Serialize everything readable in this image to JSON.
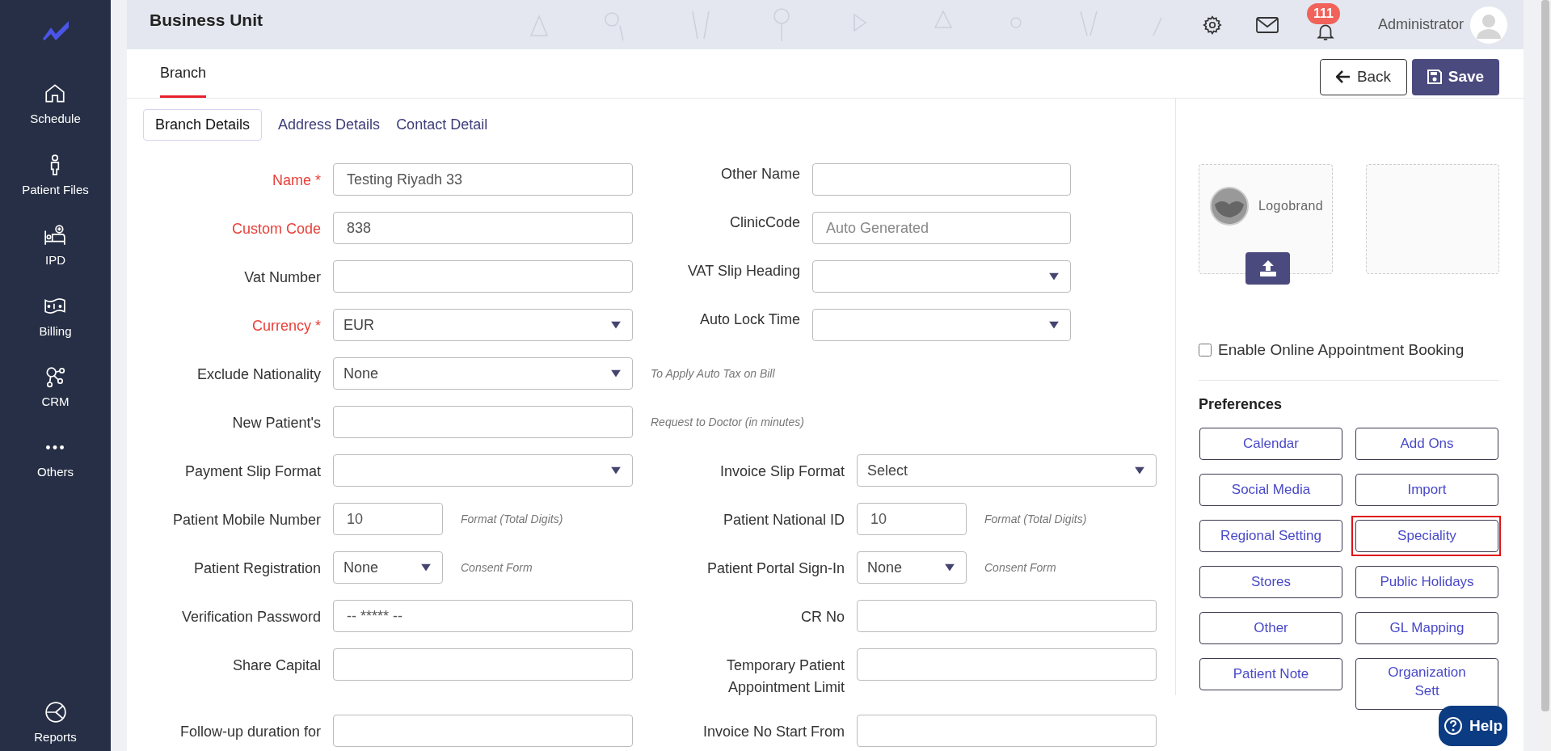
{
  "sidebar": {
    "items": [
      {
        "label": "Schedule"
      },
      {
        "label": "Patient Files"
      },
      {
        "label": "IPD"
      },
      {
        "label": "Billing"
      },
      {
        "label": "CRM"
      },
      {
        "label": "Others"
      }
    ],
    "bottom_item": {
      "label": "Reports"
    }
  },
  "header": {
    "title": "Business Unit",
    "notification_count": "111",
    "user": "Administrator"
  },
  "page_tabs": [
    {
      "label": "Branch",
      "selected": true
    }
  ],
  "actions": [
    {
      "label": "Back",
      "kind": "back"
    },
    {
      "label": "Save",
      "kind": "save"
    }
  ],
  "section_tabs": [
    {
      "label": "Branch Details",
      "selected": true
    },
    {
      "label": "Address Details",
      "selected": false
    },
    {
      "label": "Contact Detail",
      "selected": false
    }
  ],
  "rows": [
    {
      "kind": "top",
      "left": {
        "label": "Name *",
        "required": true,
        "kind": "text",
        "value": "Testing Riyadh 33"
      },
      "right": {
        "label": "Other Name",
        "required": false,
        "kind": "text"
      }
    },
    {
      "kind": "top",
      "left": {
        "label": "Custom Code",
        "required": true,
        "kind": "text",
        "value": "838"
      },
      "right": {
        "label": "ClinicCode",
        "required": false,
        "kind": "text",
        "placeholder": "Auto Generated"
      }
    },
    {
      "kind": "top",
      "left": {
        "label": "Vat Number",
        "required": false,
        "kind": "text"
      },
      "right": {
        "label": "VAT Slip Heading",
        "required": false,
        "kind": "select"
      }
    },
    {
      "kind": "top",
      "left": {
        "label": "Currency *",
        "required": true,
        "kind": "select",
        "value": "EUR"
      },
      "right": {
        "label": "Auto Lock Time",
        "required": false,
        "kind": "select"
      }
    },
    {
      "kind": "single",
      "left": {
        "label": "Exclude Nationality",
        "required": false,
        "kind": "select",
        "value": "None",
        "hint": "To Apply Auto Tax on Bill"
      }
    },
    {
      "kind": "single",
      "left": {
        "label": "New Patient's",
        "required": false,
        "kind": "text",
        "hint": "Request to Doctor (in minutes)"
      }
    },
    {
      "kind": "pair",
      "left": {
        "label": "Payment Slip Format",
        "required": false,
        "kind": "select"
      },
      "right": {
        "label": "Invoice Slip Format",
        "required": false,
        "kind": "select",
        "value": "Select"
      }
    },
    {
      "kind": "pair",
      "left": {
        "label": "Patient Mobile Number",
        "required": false,
        "kind": "short-text",
        "value": "10",
        "hint": "Format (Total Digits)"
      },
      "right": {
        "label": "Patient National ID",
        "required": false,
        "kind": "short-text",
        "value": "10",
        "hint": "Format (Total Digits)"
      }
    },
    {
      "kind": "pair",
      "left": {
        "label": "Patient Registration",
        "required": false,
        "kind": "short-select",
        "value": "None",
        "hint": "Consent Form"
      },
      "right": {
        "label": "Patient Portal Sign-In",
        "required": false,
        "kind": "short-select",
        "value": "None",
        "hint": "Consent Form"
      }
    },
    {
      "kind": "pair",
      "left": {
        "label": "Verification Password",
        "required": false,
        "kind": "text",
        "value": "-- ***** --"
      },
      "right": {
        "label": "CR No",
        "required": false,
        "kind": "wide-text"
      }
    },
    {
      "kind": "pair",
      "left": {
        "label": "Share Capital",
        "required": false,
        "kind": "text"
      },
      "right": {
        "label": "Temporary Patient Appointment Limit",
        "required": false,
        "kind": "wide-text"
      }
    },
    {
      "kind": "pair",
      "left": {
        "label": "Follow-up duration for",
        "required": false,
        "kind": "text"
      },
      "right": {
        "label": "Invoice No Start From",
        "required": false,
        "kind": "wide-text"
      }
    }
  ],
  "logo": {
    "label": "Logobrand"
  },
  "online_booking": {
    "label": "Enable Online Appointment Booking",
    "checked": false
  },
  "preferences": {
    "title": "Preferences",
    "buttons": [
      {
        "label": "Calendar",
        "highlighted": false
      },
      {
        "label": "Add Ons",
        "highlighted": false
      },
      {
        "label": "Social Media",
        "highlighted": false
      },
      {
        "label": "Import",
        "highlighted": false
      },
      {
        "label": "Regional Setting",
        "highlighted": false
      },
      {
        "label": "Speciality",
        "highlighted": true
      },
      {
        "label": "Stores",
        "highlighted": false
      },
      {
        "label": "Public Holidays",
        "highlighted": false
      },
      {
        "label": "Other",
        "highlighted": false
      },
      {
        "label": "GL Mapping",
        "highlighted": false
      },
      {
        "label": "Patient Note",
        "highlighted": false
      },
      {
        "label": "Organization\nSett",
        "highlighted": false
      }
    ]
  },
  "help": {
    "label": "Help"
  }
}
